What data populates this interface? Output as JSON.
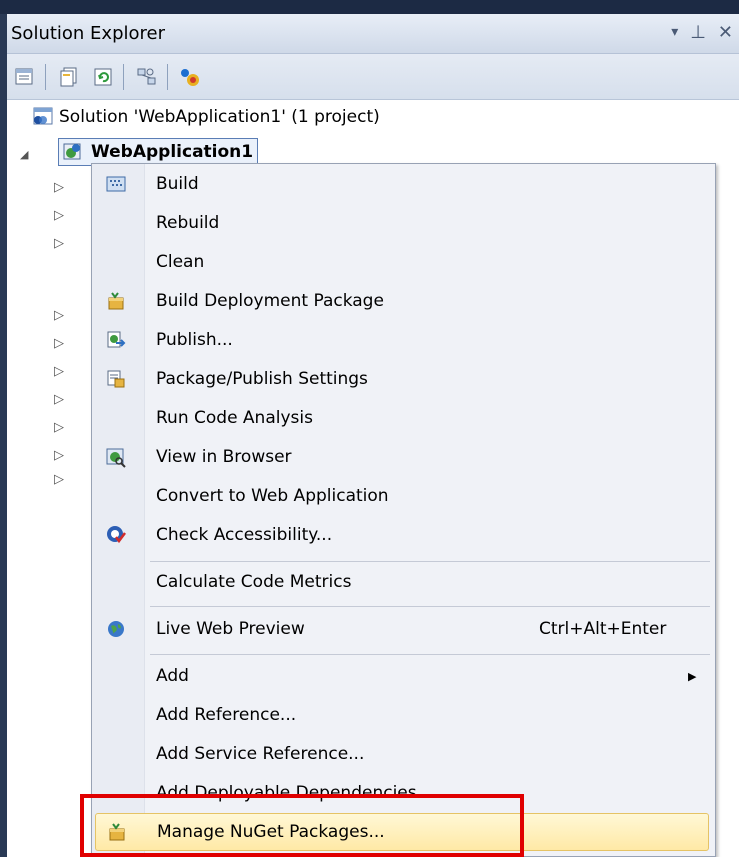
{
  "panel": {
    "title": "Solution Explorer",
    "controls": {
      "dropdown": "▾",
      "pin": "⊥",
      "close": "✕"
    },
    "toolbar": [
      "properties-icon",
      "show-all-files-icon",
      "refresh-icon",
      "view-class-diagram-icon",
      "nuget-icon"
    ]
  },
  "tree": {
    "solution_label": "Solution 'WebApplication1' (1 project)",
    "project_label": "WebApplication1",
    "expanded_glyph": "◢",
    "collapsed_glyph": "▷"
  },
  "context_menu": {
    "items": [
      {
        "label": "Build",
        "icon": "build-icon"
      },
      {
        "label": "Rebuild",
        "icon": ""
      },
      {
        "label": "Clean",
        "icon": ""
      },
      {
        "label": "Build Deployment Package",
        "icon": "package-icon"
      },
      {
        "label": "Publish...",
        "icon": "publish-icon"
      },
      {
        "label": "Package/Publish Settings",
        "icon": "settings-icon"
      },
      {
        "label": "Run Code Analysis",
        "icon": ""
      },
      {
        "label": "View in Browser",
        "icon": "browser-icon"
      },
      {
        "label": "Convert to Web Application",
        "icon": ""
      },
      {
        "label": "Check Accessibility...",
        "icon": "accessibility-icon"
      },
      {
        "label": "Calculate Code Metrics",
        "icon": ""
      },
      {
        "label": "Live Web Preview",
        "icon": "globe-icon",
        "shortcut": "Ctrl+Alt+Enter"
      },
      {
        "label": "Add",
        "icon": "",
        "submenu_glyph": "▶"
      },
      {
        "label": "Add Reference...",
        "icon": ""
      },
      {
        "label": "Add Service Reference...",
        "icon": ""
      },
      {
        "label": "Add Deployable Dependencies...",
        "icon": ""
      },
      {
        "label": "Manage NuGet Packages...",
        "icon": "nuget-icon",
        "highlighted": true
      }
    ]
  },
  "colors": {
    "frame": "#293955",
    "highlight_fill": "#ffe9a6",
    "highlight_border": "#e5c365",
    "annotation_red": "#e00000"
  }
}
